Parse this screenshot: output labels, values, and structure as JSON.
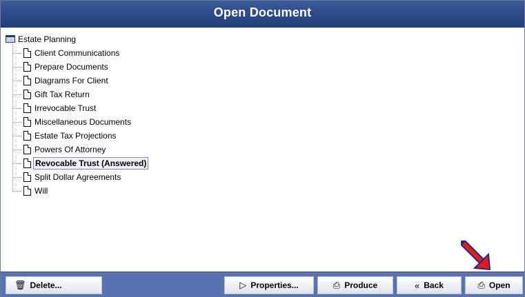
{
  "window": {
    "title": "Open Document"
  },
  "tree": {
    "root": "Estate Planning",
    "items": [
      {
        "label": "Client Communications",
        "selected": false
      },
      {
        "label": "Prepare Documents",
        "selected": false
      },
      {
        "label": "Diagrams For Client",
        "selected": false
      },
      {
        "label": "Gift Tax Return",
        "selected": false
      },
      {
        "label": "Irrevocable Trust",
        "selected": false
      },
      {
        "label": "Miscellaneous Documents",
        "selected": false
      },
      {
        "label": "Estate Tax Projections",
        "selected": false
      },
      {
        "label": "Powers Of Attorney",
        "selected": false
      },
      {
        "label": "Revocable Trust (Answered)",
        "selected": true
      },
      {
        "label": "Split Dollar Agreements",
        "selected": false
      },
      {
        "label": "Will",
        "selected": false
      }
    ]
  },
  "buttons": {
    "delete": {
      "label": "Delete...",
      "icon": "trash-icon"
    },
    "properties": {
      "label": "Properties...",
      "icon": "properties-icon"
    },
    "produce": {
      "label": "Produce",
      "icon": "printer-icon"
    },
    "back": {
      "label": "Back",
      "icon": "back-arrow-icon"
    },
    "open": {
      "label": "Open",
      "icon": "open-icon"
    }
  },
  "annotation": {
    "color": "#e41b1b"
  }
}
